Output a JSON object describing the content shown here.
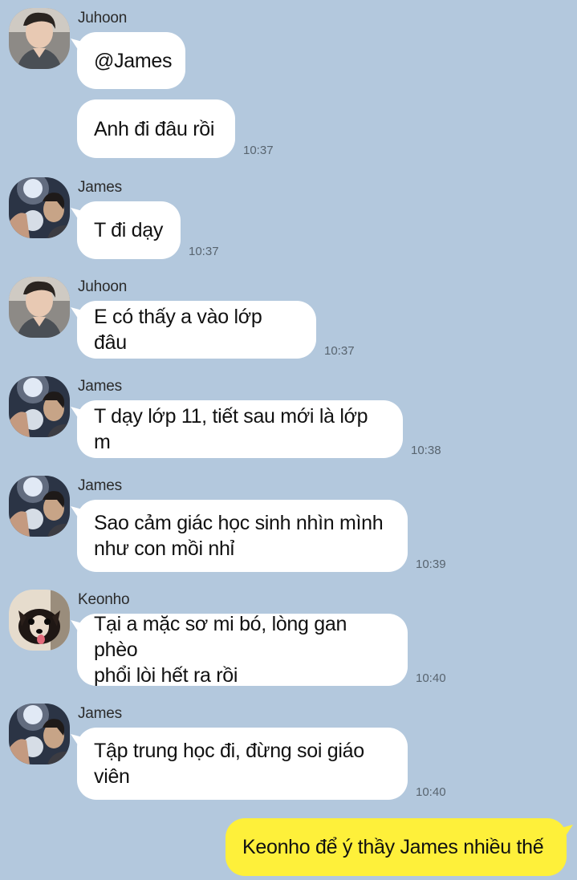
{
  "colors": {
    "background": "#b3c8dd",
    "incoming_bubble": "#ffffff",
    "outgoing_bubble": "#fef03a"
  },
  "messages": [
    {
      "sender": "Juhoon",
      "avatar": "juhoon-avatar",
      "text": "@James",
      "time": ""
    },
    {
      "sender": "",
      "avatar": "",
      "text": "Anh đi đâu rồi",
      "time": "10:37"
    },
    {
      "sender": "James",
      "avatar": "james-avatar",
      "text": "T đi dạy",
      "time": "10:37"
    },
    {
      "sender": "Juhoon",
      "avatar": "juhoon-avatar",
      "text": "E có thấy a vào lớp đâu",
      "time": "10:37"
    },
    {
      "sender": "James",
      "avatar": "james-avatar",
      "text": "T dạy lớp 11, tiết sau mới là lớp m",
      "time": "10:38"
    },
    {
      "sender": "James",
      "avatar": "james-avatar",
      "text": "Sao cảm giác học sinh nhìn mình\nnhư con mồi nhỉ",
      "time": "10:39"
    },
    {
      "sender": "Keonho",
      "avatar": "keonho-avatar",
      "text": "Tại a mặc sơ mi bó, lòng gan phèo\nphổi lòi hết ra rồi",
      "time": "10:40"
    },
    {
      "sender": "James",
      "avatar": "james-avatar",
      "text": "Tập trung học đi, đừng soi giáo\nviên",
      "time": "10:40"
    },
    {
      "sender": "me",
      "avatar": "",
      "text": "Keonho để ý thầy James nhiều thế",
      "time": ""
    }
  ]
}
